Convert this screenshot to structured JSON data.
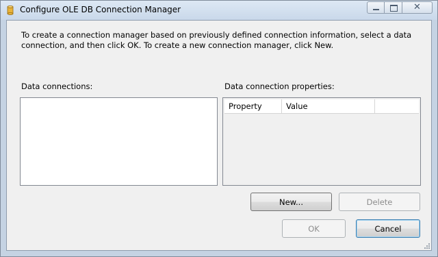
{
  "window": {
    "title": "Configure OLE DB Connection Manager",
    "app_icon": "cylinder-database-icon",
    "caption_buttons": [
      "minimize-icon",
      "maximize-icon",
      "close-icon"
    ]
  },
  "dialog": {
    "instructions": "To create a connection manager based on previously defined connection information, select a data connection, and then click OK. To create a new connection manager, click New.",
    "data_connections_label": "Data connections:",
    "data_connections_items": [],
    "properties_label": "Data connection properties:",
    "properties_grid": {
      "columns": [
        "Property",
        "Value"
      ],
      "rows": []
    }
  },
  "buttons": {
    "new_label": "New...",
    "delete_label": "Delete",
    "ok_label": "OK",
    "cancel_label": "Cancel"
  },
  "colors": {
    "title_bar": "#c9d8ea",
    "client_background": "#f0f0f0",
    "default_button_border": "#3c7fb1"
  }
}
